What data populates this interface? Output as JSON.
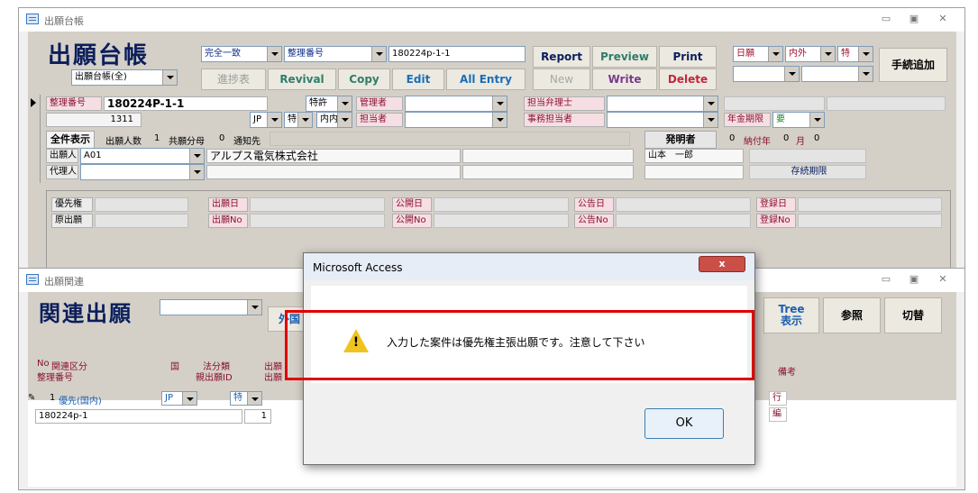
{
  "main_window": {
    "title": "出願台帳",
    "form_title": "出願台帳",
    "view_combo": "出願台帳(全)",
    "search_mode": "完全一致",
    "search_field": "整理番号",
    "search_value": "180224p-1-1",
    "buttons": {
      "report": "Report",
      "preview": "Preview",
      "print": "Print",
      "shinchoku": "進捗表",
      "revival": "Revival",
      "copy": "Copy",
      "edit": "Edit",
      "all_entry": "All Entry",
      "new": "New",
      "write": "Write",
      "delete": "Delete",
      "procedure_add": "手続追加"
    },
    "filters": [
      "日願",
      "内外",
      "特"
    ],
    "record": {
      "seiri_label": "整理番号",
      "seiri_value": "180224P-1-1",
      "code": "1311",
      "type": "特許",
      "country": "JP",
      "kind": "特",
      "naigai": "内内",
      "kanri_label": "管理者",
      "tanto_label": "担当者",
      "bengoshi_label": "担当弁理士",
      "jimu_label": "事務担当者",
      "nenkin_label": "年金期限",
      "nenkin_value": "要",
      "nofu_label": "納付年",
      "nofu_year": "0",
      "nofu_month_label": "月",
      "nofu_month": "0",
      "zenken": "全件表示",
      "applicants_count_label": "出願人数",
      "applicants_count": "1",
      "kyoyu_label": "共願分母",
      "kyoyu": "0",
      "tsuchi_label": "通知先",
      "inventor_label": "発明者",
      "inventor_count": "0",
      "applicant_label": "出願人",
      "applicant_code": "A01",
      "applicant_name": "アルプス電気株式会社",
      "inventor_name": "山本　一郎",
      "agent_label": "代理人",
      "sonzoku_label": "存続期限",
      "yusen_label": "優先権",
      "genshutsugan_label": "原出願",
      "date_labels": [
        "出願日",
        "公開日",
        "公告日",
        "登録日"
      ],
      "no_labels": [
        "出願No",
        "公開No",
        "公告No",
        "登録No"
      ]
    }
  },
  "related_window": {
    "title": "出願関連",
    "form_title": "関連出願",
    "gaikoku": "外国",
    "tree_btn": "Tree\n表示",
    "sansho_btn": "参照",
    "kirikae_btn": "切替",
    "headers": {
      "no": "No",
      "kanren": "関連区分",
      "seiri": "整理番号",
      "country": "国",
      "hobun": "法分類",
      "oya": "親出願ID",
      "shutsu1": "出願",
      "shutsu2": "出願",
      "biko": "備考"
    },
    "row": {
      "no": "1",
      "kubun": "優先(国内)",
      "country": "JP",
      "kind": "特",
      "seiri": "180224p-1",
      "oya_id": "1",
      "side1": "行",
      "side2": "編"
    }
  },
  "dialog": {
    "title": "Microsoft Access",
    "close": "x",
    "message": "入力した案件は優先権主張出願です。注意して下さい",
    "ok": "OK"
  },
  "colors": {
    "form_bg": "#d4d0c8",
    "title_navy": "#0b1e5c",
    "label_pink": "#f6dfe4",
    "highlight_red": "#e00000",
    "close_red": "#c94f47"
  }
}
